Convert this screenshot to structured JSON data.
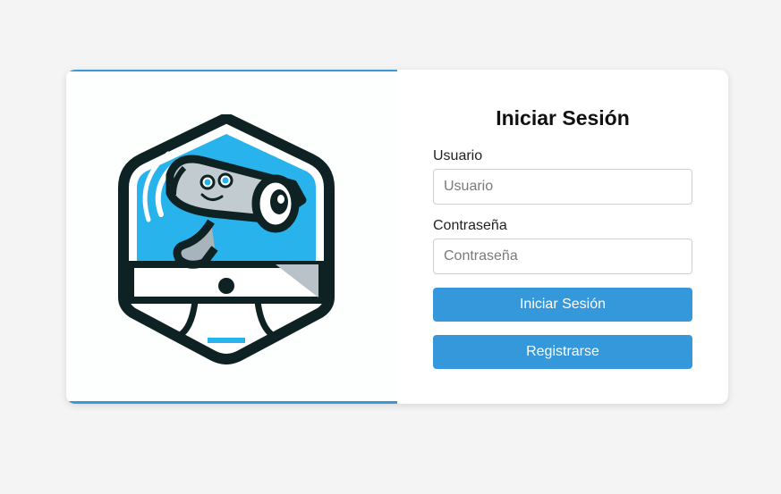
{
  "login": {
    "title": "Iniciar Sesión",
    "username_label": "Usuario",
    "username_placeholder": "Usuario",
    "username_value": "",
    "password_label": "Contraseña",
    "password_placeholder": "Contraseña",
    "password_value": "",
    "login_button": "Iniciar Sesión",
    "register_button": "Registrarse"
  },
  "logo": {
    "icon": "security-camera-shield-logo"
  },
  "colors": {
    "accent": "#3598db",
    "logo_blue": "#29b3ec",
    "logo_outline": "#0e2224",
    "background": "#f4f4f4"
  }
}
